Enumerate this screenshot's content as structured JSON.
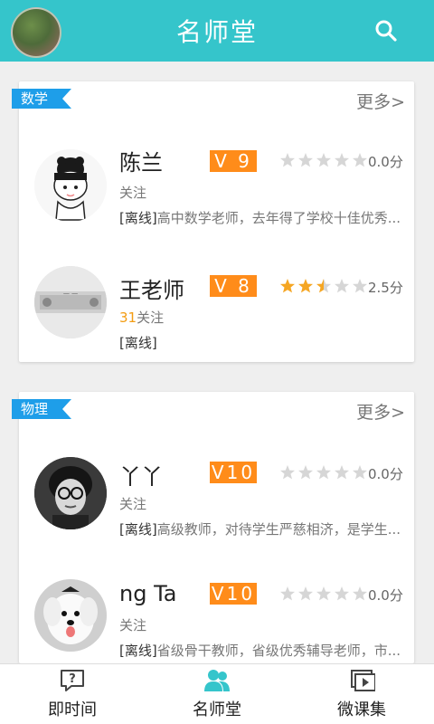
{
  "header": {
    "title": "名师堂",
    "avatar_icon": "user-avatar",
    "search_icon": "search-icon"
  },
  "sections": [
    {
      "tag": "数学",
      "more": "更多>",
      "teachers": [
        {
          "name": "陈兰",
          "level": "V 9",
          "rating": 0.0,
          "score": "0.0分",
          "follow_count": "",
          "follow_label": "关注",
          "status": "[离线]",
          "intro": "高中数学老师，去年得了学校十佳优秀..."
        },
        {
          "name": "王老师",
          "level": "V 8",
          "rating": 2.5,
          "score": "2.5分",
          "follow_count": "31",
          "follow_label": "关注",
          "status": "[离线]",
          "intro": ""
        }
      ]
    },
    {
      "tag": "物理",
      "more": "更多>",
      "teachers": [
        {
          "name": "丫丫",
          "level": "V10",
          "rating": 0.0,
          "score": "0.0分",
          "follow_count": "",
          "follow_label": "关注",
          "status": "[离线]",
          "intro": "高级教师，对待学生严慈相济，是学生..."
        },
        {
          "name": "ng    Ta",
          "level": "V10",
          "rating": 0.0,
          "score": "0.0分",
          "follow_count": "",
          "follow_label": "关注",
          "status": "[离线]",
          "intro": "省级骨干教师，省级优秀辅导老师，市..."
        }
      ]
    }
  ],
  "nav": [
    {
      "label": "即时间",
      "icon": "question-chat-icon",
      "active": false
    },
    {
      "label": "名师堂",
      "icon": "users-icon",
      "active": true
    },
    {
      "label": "微课集",
      "icon": "video-play-icon",
      "active": false
    }
  ],
  "colors": {
    "primary": "#35c5cb",
    "tag": "#1e9ee9",
    "vip": "#ff8c1a",
    "star_on": "#f5a623",
    "star_off": "#d6d6d6"
  }
}
